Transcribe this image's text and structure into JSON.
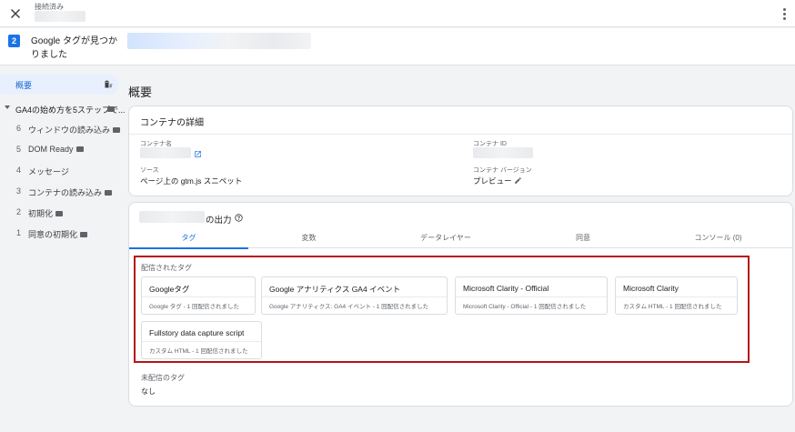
{
  "topbar": {
    "connected_label": "接続済み",
    "close_icon": "close-icon",
    "more_icon": "more-vert-icon"
  },
  "header": {
    "step": "2",
    "title": "Google タグが見つかりました"
  },
  "sidebar": {
    "summary_label": "概要",
    "group_label": "GA4の始め方を5ステップで...",
    "items": [
      {
        "num": "6",
        "label": "ウィンドウの読み込み"
      },
      {
        "num": "5",
        "label": "DOM Ready"
      },
      {
        "num": "4",
        "label": "メッセージ"
      },
      {
        "num": "3",
        "label": "コンテナの読み込み"
      },
      {
        "num": "2",
        "label": "初期化"
      },
      {
        "num": "1",
        "label": "同意の初期化"
      }
    ]
  },
  "main": {
    "heading": "概要",
    "details": {
      "title": "コンテナの詳細",
      "container_name_label": "コンテナ名",
      "container_id_label": "コンテナ ID",
      "source_label": "ソース",
      "source_value": "ページ上の gtm.js スニペット",
      "version_label": "コンテナ バージョン",
      "version_value": "プレビュー"
    },
    "output": {
      "title_suffix": "の出力",
      "tabs": [
        "タグ",
        "変数",
        "データレイヤー",
        "同意",
        "コンソール (0)"
      ],
      "active_tab": 0,
      "fired_label": "配信されたタグ",
      "tags": [
        {
          "name": "Googleタグ",
          "desc": "Google タグ - 1 回配信されました"
        },
        {
          "name": "Google アナリティクス GA4 イベント",
          "desc": "Google アナリティクス: GA4 イベント - 1 回配信されました"
        },
        {
          "name": "Microsoft Clarity - Official",
          "desc": "Microsoft Clarity - Official - 1 回配信されました"
        },
        {
          "name": "Microsoft Clarity",
          "desc": "カスタム HTML - 1 回配信されました"
        },
        {
          "name": "Fullstory data capture script",
          "desc": "カスタム HTML - 1 回配信されました"
        }
      ],
      "not_fired_label": "未配信のタグ",
      "not_fired_value": "なし"
    }
  },
  "colors": {
    "accent": "#1a73e8",
    "highlight_border": "#b3141b",
    "selected_bg": "#e8f0fe"
  }
}
